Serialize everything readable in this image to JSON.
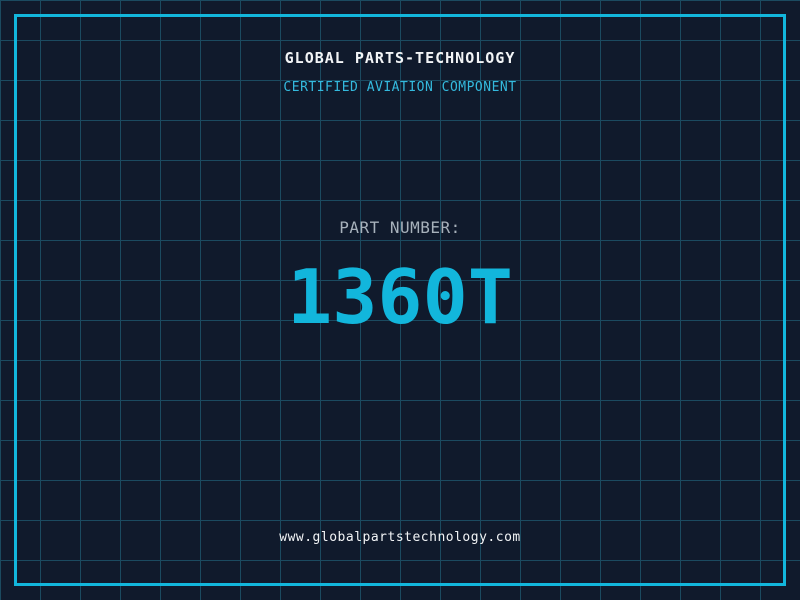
{
  "header": {
    "title": "GLOBAL PARTS-TECHNOLOGY",
    "subtitle": "CERTIFIED AVIATION COMPONENT"
  },
  "part": {
    "label": "PART NUMBER:",
    "number": "1360T"
  },
  "footer": {
    "website": "www.globalpartstechnology.com"
  },
  "colors": {
    "background": "#101a2c",
    "grid_line": "#1b4a60",
    "frame_border": "#12b6dc",
    "title_text": "#f2f4f6",
    "subtitle_text": "#34bade",
    "part_label_text": "#a7b1bb",
    "part_number_text": "#12b6dc",
    "website_text": "#f2f4f6"
  }
}
